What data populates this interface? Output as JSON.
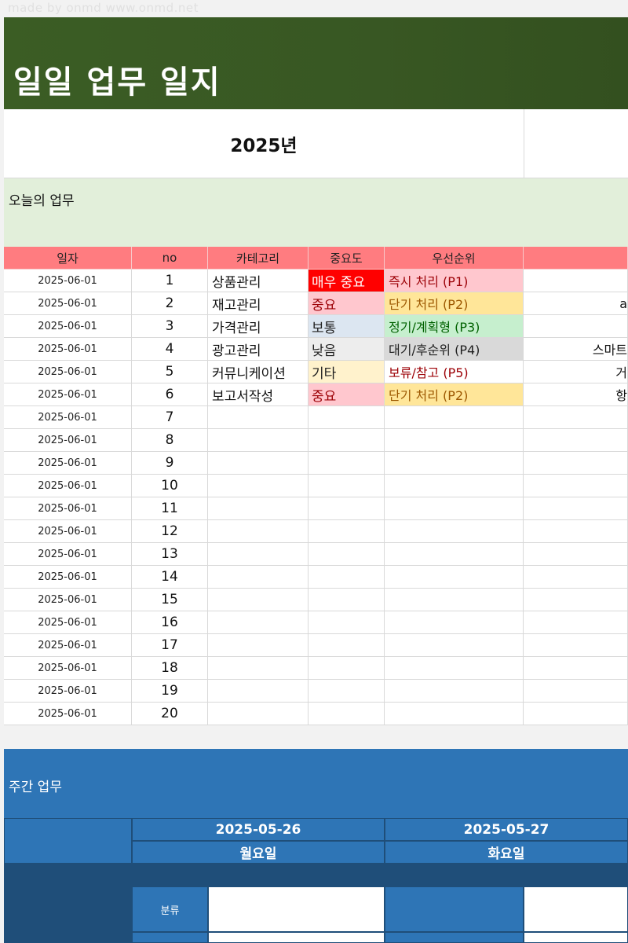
{
  "watermark": "made by onmd www.onmd.net",
  "title": "일일 업무 일지",
  "year": "2025년",
  "today_label": "오늘의 업무",
  "table": {
    "headers": {
      "date": "일자",
      "no": "no",
      "category": "카테고리",
      "importance": "중요도",
      "priority": "우선순위"
    },
    "rows": [
      {
        "date": "2025-06-01",
        "no": "1",
        "category": "상품관리",
        "importance": "매우 중요",
        "priority": "즉시 처리 (P1)",
        "more": ""
      },
      {
        "date": "2025-06-01",
        "no": "2",
        "category": "재고관리",
        "importance": "중요",
        "priority": "단기 처리 (P2)",
        "more": "a"
      },
      {
        "date": "2025-06-01",
        "no": "3",
        "category": "가격관리",
        "importance": "보통",
        "priority": "정기/계획형 (P3)",
        "more": ""
      },
      {
        "date": "2025-06-01",
        "no": "4",
        "category": "광고관리",
        "importance": "낮음",
        "priority": "대기/후순위 (P4)",
        "more": "스마트"
      },
      {
        "date": "2025-06-01",
        "no": "5",
        "category": "커뮤니케이션",
        "importance": "기타",
        "priority": "보류/참고 (P5)",
        "more": "거"
      },
      {
        "date": "2025-06-01",
        "no": "6",
        "category": "보고서작성",
        "importance": "중요",
        "priority": "단기 처리 (P2)",
        "more": "항"
      },
      {
        "date": "2025-06-01",
        "no": "7",
        "category": "",
        "importance": "",
        "priority": "",
        "more": ""
      },
      {
        "date": "2025-06-01",
        "no": "8",
        "category": "",
        "importance": "",
        "priority": "",
        "more": ""
      },
      {
        "date": "2025-06-01",
        "no": "9",
        "category": "",
        "importance": "",
        "priority": "",
        "more": ""
      },
      {
        "date": "2025-06-01",
        "no": "10",
        "category": "",
        "importance": "",
        "priority": "",
        "more": ""
      },
      {
        "date": "2025-06-01",
        "no": "11",
        "category": "",
        "importance": "",
        "priority": "",
        "more": ""
      },
      {
        "date": "2025-06-01",
        "no": "12",
        "category": "",
        "importance": "",
        "priority": "",
        "more": ""
      },
      {
        "date": "2025-06-01",
        "no": "13",
        "category": "",
        "importance": "",
        "priority": "",
        "more": ""
      },
      {
        "date": "2025-06-01",
        "no": "14",
        "category": "",
        "importance": "",
        "priority": "",
        "more": ""
      },
      {
        "date": "2025-06-01",
        "no": "15",
        "category": "",
        "importance": "",
        "priority": "",
        "more": ""
      },
      {
        "date": "2025-06-01",
        "no": "16",
        "category": "",
        "importance": "",
        "priority": "",
        "more": ""
      },
      {
        "date": "2025-06-01",
        "no": "17",
        "category": "",
        "importance": "",
        "priority": "",
        "more": ""
      },
      {
        "date": "2025-06-01",
        "no": "18",
        "category": "",
        "importance": "",
        "priority": "",
        "more": ""
      },
      {
        "date": "2025-06-01",
        "no": "19",
        "category": "",
        "importance": "",
        "priority": "",
        "more": ""
      },
      {
        "date": "2025-06-01",
        "no": "20",
        "category": "",
        "importance": "",
        "priority": "",
        "more": ""
      }
    ]
  },
  "styles": {
    "importance": {
      "매우 중요": {
        "bg": "#ff0000",
        "fg": "#ffffff"
      },
      "중요": {
        "bg": "#ffc7ce",
        "fg": "#9c0006"
      },
      "보통": {
        "bg": "#dce6f1",
        "fg": "#1f1f1f"
      },
      "낮음": {
        "bg": "#ededed",
        "fg": "#1f1f1f"
      },
      "기타": {
        "bg": "#fff2cc",
        "fg": "#1f1f1f"
      }
    },
    "priority": {
      "즉시 처리 (P1)": {
        "bg": "#ffc7ce",
        "fg": "#9c0006"
      },
      "단기 처리 (P2)": {
        "bg": "#ffe699",
        "fg": "#9c5700"
      },
      "정기/계획형 (P3)": {
        "bg": "#c6efce",
        "fg": "#006100"
      },
      "대기/후순위 (P4)": {
        "bg": "#d9d9d9",
        "fg": "#1f1f1f"
      },
      "보류/참고 (P5)": {
        "bg": "#ffffff",
        "fg": "#9c0006"
      }
    }
  },
  "weekly": {
    "title": "주간 업무",
    "days": [
      {
        "date": "2025-05-26",
        "weekday": "월요일"
      },
      {
        "date": "2025-05-27",
        "weekday": "화요일"
      }
    ],
    "category_label": "분류"
  }
}
